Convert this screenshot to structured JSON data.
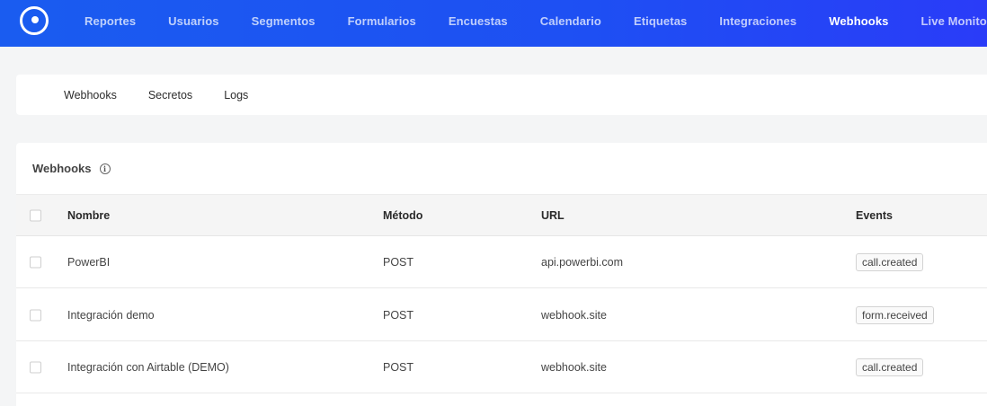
{
  "nav": {
    "logo": "logo-icon",
    "items": [
      {
        "label": "Reportes"
      },
      {
        "label": "Usuarios"
      },
      {
        "label": "Segmentos"
      },
      {
        "label": "Formularios"
      },
      {
        "label": "Encuestas"
      },
      {
        "label": "Calendario"
      },
      {
        "label": "Etiquetas"
      },
      {
        "label": "Integraciones"
      },
      {
        "label": "Webhooks"
      },
      {
        "label": "Live Monitor"
      }
    ],
    "active": "Webhooks"
  },
  "subtabs": [
    {
      "label": "Webhooks"
    },
    {
      "label": "Secretos"
    },
    {
      "label": "Logs"
    }
  ],
  "card": {
    "title": "Webhooks",
    "info_icon": "info-icon"
  },
  "table": {
    "headers": {
      "name": "Nombre",
      "method": "Método",
      "url": "URL",
      "events": "Events"
    },
    "rows": [
      {
        "name": "PowerBI",
        "method": "POST",
        "url": "api.powerbi.com",
        "event": "call.created"
      },
      {
        "name": "Integración demo",
        "method": "POST",
        "url": "webhook.site",
        "event": "form.received"
      },
      {
        "name": "Integración con Airtable (DEMO)",
        "method": "POST",
        "url": "webhook.site",
        "event": "call.created"
      }
    ]
  },
  "colors": {
    "topbar": "#1e4ff3",
    "page_bg": "#f4f5f6",
    "header_bg": "#f5f5f5"
  }
}
